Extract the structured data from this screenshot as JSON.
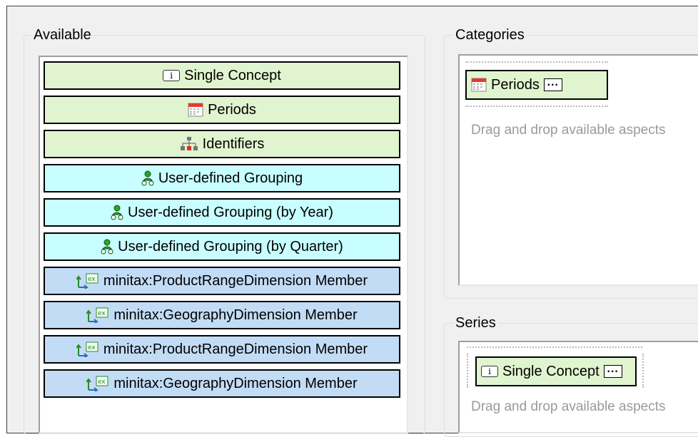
{
  "available": {
    "title": "Available",
    "items": [
      {
        "label": "Single Concept",
        "icon": "info-icon",
        "color": "#e0f5cf"
      },
      {
        "label": "Periods",
        "icon": "calendar-icon",
        "color": "#e0f5cf"
      },
      {
        "label": "Identifiers",
        "icon": "hierarchy-icon",
        "color": "#e0f5cf"
      },
      {
        "label": "User-defined Grouping",
        "icon": "user-group-icon",
        "color": "#c8feff"
      },
      {
        "label": "User-defined Grouping (by Year)",
        "icon": "user-group-icon",
        "color": "#c8feff"
      },
      {
        "label": "User-defined Grouping (by Quarter)",
        "icon": "user-group-icon",
        "color": "#c8feff"
      },
      {
        "label": "minitax:ProductRangeDimension Member",
        "icon": "dimension-icon",
        "color": "#c2dcf6"
      },
      {
        "label": "minitax:GeographyDimension Member",
        "icon": "dimension-icon",
        "color": "#c2dcf6"
      },
      {
        "label": "minitax:ProductRangeDimension Member",
        "icon": "dimension-icon",
        "color": "#c2dcf6"
      },
      {
        "label": "minitax:GeographyDimension Member",
        "icon": "dimension-icon",
        "color": "#c2dcf6"
      }
    ]
  },
  "categories": {
    "title": "Categories",
    "chip": {
      "label": "Periods",
      "icon": "calendar-icon",
      "menu": "..."
    },
    "hint": "Drag and drop available aspects"
  },
  "series": {
    "title": "Series",
    "chip": {
      "label": "Single Concept",
      "icon": "info-icon",
      "menu": "..."
    },
    "hint": "Drag and drop available aspects"
  }
}
